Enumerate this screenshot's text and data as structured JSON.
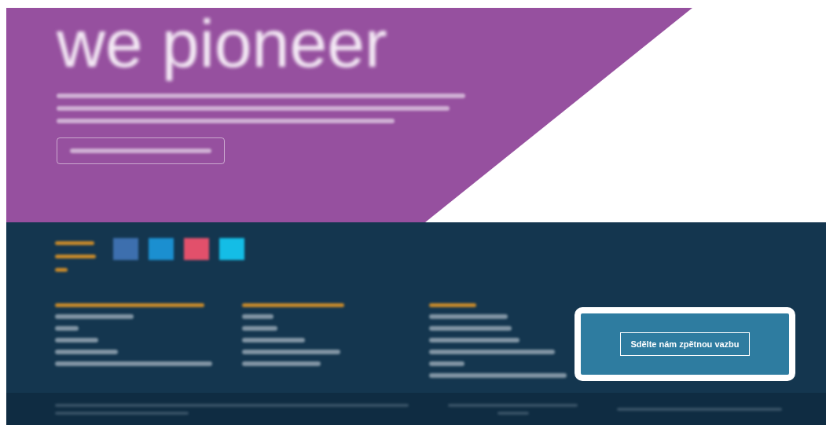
{
  "hero": {
    "heading": "we pioneer"
  },
  "social_icons": [
    {
      "color": "#3d6fae"
    },
    {
      "color": "#1b8fd0"
    },
    {
      "color": "#e2506b"
    },
    {
      "color": "#14bde6"
    }
  ],
  "feedback": {
    "button": "Sdělte nám zpětnou vazbu",
    "highlighted": true
  }
}
